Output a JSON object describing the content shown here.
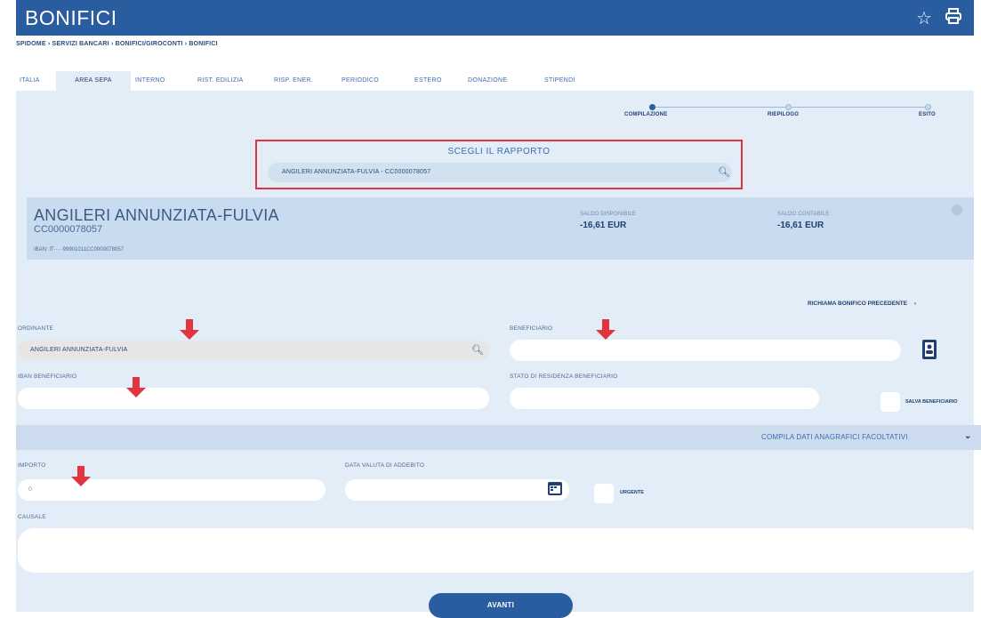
{
  "app": {
    "title": "BONIFICI",
    "icons": [
      "star-icon",
      "print-icon"
    ]
  },
  "breadcrumb": "SPIDOME › SERVIZI BANCARI › BONIFICI/GIROCONTI › BONIFICI",
  "tabs": [
    {
      "label": "ITALIA",
      "active": false
    },
    {
      "label": "AREA SEPA",
      "active": true
    },
    {
      "label": "INTERNO",
      "active": false
    },
    {
      "label": "RIST. EDILIZIA",
      "active": false
    },
    {
      "label": "RISP. ENER.",
      "active": false
    },
    {
      "label": "PERIODICO",
      "active": false
    },
    {
      "label": "ESTERO",
      "active": false
    },
    {
      "label": "DONAZIONE",
      "active": false
    },
    {
      "label": "STIPENDI",
      "active": false
    }
  ],
  "stepper": {
    "steps": [
      {
        "label": "COMPILAZIONE",
        "active": true
      },
      {
        "label": "RIEPILOGO",
        "active": false
      },
      {
        "label": "ESITO",
        "active": false
      }
    ]
  },
  "rapporto": {
    "title": "SCEGLI IL RAPPORTO",
    "value": "ANGILERI ANNUNZIATA-FULVIA - CC0000078057"
  },
  "account": {
    "name": "ANGILERI ANNUNZIATA-FULVIA",
    "number": "CC0000078057",
    "iban": "IBAN: IT·····99901011CC0000078057",
    "saldo_disponibile_label": "SALDO DISPONIBILE",
    "saldo_disponibile": "-16,61 EUR",
    "saldo_contabile_label": "SALDO CONTABILE",
    "saldo_contabile": "-16,61 EUR"
  },
  "richiama": "RICHIAMA BONIFICO PRECEDENTE",
  "form": {
    "ordinante_label": "ORDINANTE",
    "ordinante_value": "ANGILERI ANNUNZIATA-FULVIA",
    "beneficiario_label": "BENEFICIARIO",
    "beneficiario_value": "",
    "iban_label": "IBAN BENEFICIARIO",
    "iban_value": "",
    "stato_label": "STATO DI RESIDENZA BENEFICIARIO",
    "stato_value": "",
    "salva_label": "SALVA BENEFICIARIO",
    "compila_label": "COMPILA DATI ANAGRAFICI FACOLTATIVI",
    "importo_label": "IMPORTO",
    "importo_value": "0",
    "data_label": "DATA VALUTA DI ADDEBITO",
    "data_value": "",
    "urgente_label": "URGENTE",
    "causale_label": "CAUSALE",
    "causale_value": ""
  },
  "avanti": "AVANTI",
  "colors": {
    "brand": "#2a5d9f",
    "panel": "#e3edf7",
    "highlight": "#e0353d"
  }
}
